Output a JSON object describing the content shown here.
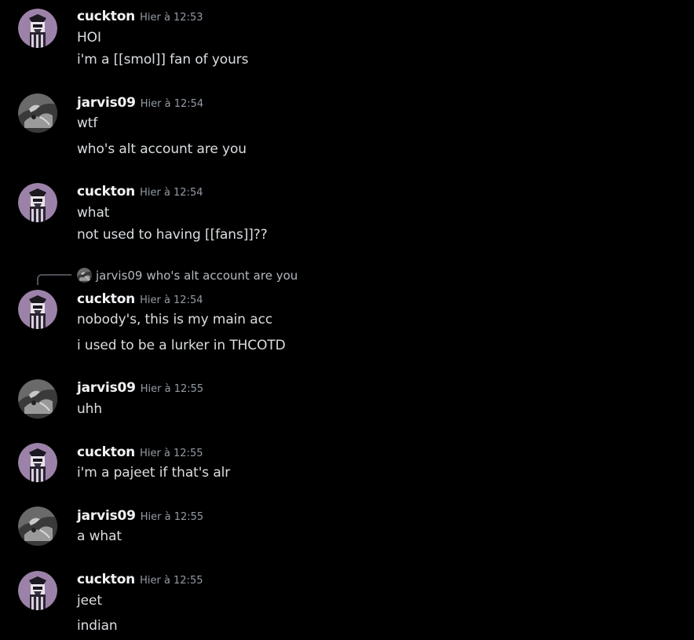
{
  "colors": {
    "background": "#000000",
    "username": "#f2f3f5",
    "timestamp": "#949ba4",
    "message_text": "#dbdee1",
    "reply_spine": "#4e5058"
  },
  "users": {
    "cuckton": {
      "name": "cuckton",
      "avatar": "cuckton-avatar-icon"
    },
    "jarvis09": {
      "name": "jarvis09",
      "avatar": "jarvis09-avatar-icon"
    }
  },
  "messages": [
    {
      "author": "cuckton",
      "timestamp": "Hier à 12:53",
      "lines": [
        "HOI",
        "i'm a [[smol]] fan of yours"
      ]
    },
    {
      "author": "jarvis09",
      "timestamp": "Hier à 12:54",
      "lines": [
        "wtf",
        "who's alt account are you"
      ]
    },
    {
      "author": "cuckton",
      "timestamp": "Hier à 12:54",
      "lines": [
        "what",
        "not used to having [[fans]]??"
      ]
    },
    {
      "author": "cuckton",
      "timestamp": "Hier à 12:54",
      "reply": {
        "author": "jarvis09",
        "text": "who's alt account are you"
      },
      "lines": [
        "nobody's, this is my main acc",
        "i used to be a lurker in THCOTD"
      ]
    },
    {
      "author": "jarvis09",
      "timestamp": "Hier à 12:55",
      "lines": [
        "uhh"
      ]
    },
    {
      "author": "cuckton",
      "timestamp": "Hier à 12:55",
      "lines": [
        "i'm a pajeet if that's alr"
      ]
    },
    {
      "author": "jarvis09",
      "timestamp": "Hier à 12:55",
      "lines": [
        "a what"
      ]
    },
    {
      "author": "cuckton",
      "timestamp": "Hier à 12:55",
      "lines": [
        "jeet",
        "indian"
      ]
    }
  ]
}
